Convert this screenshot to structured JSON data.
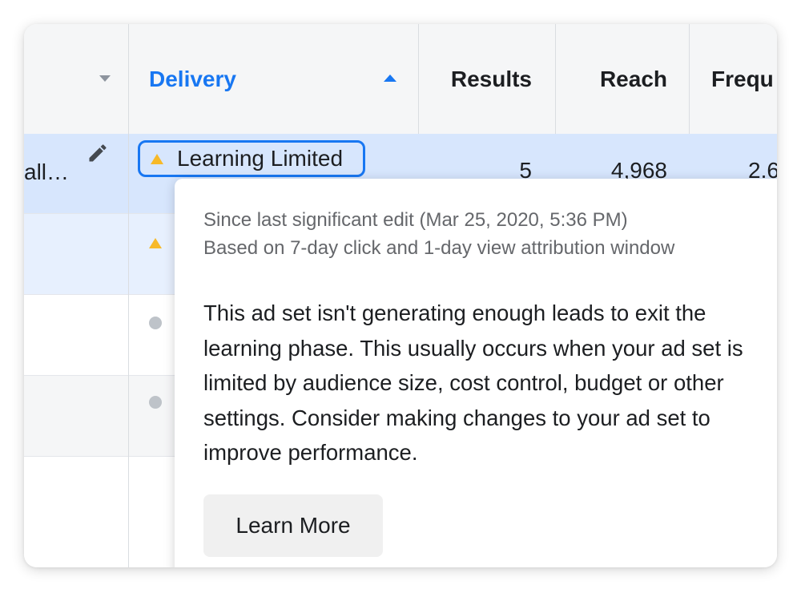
{
  "header": {
    "columns": [
      {
        "label": ""
      },
      {
        "label": "Delivery",
        "sort": "ascending"
      },
      {
        "label": "Results"
      },
      {
        "label": "Reach"
      },
      {
        "label": "Frequ"
      }
    ]
  },
  "rows": [
    {
      "name": "all…",
      "delivery_status": "Learning Limited",
      "status_icon": "warning-triangle-icon",
      "results": "5",
      "reach": "4,968",
      "frequency": "2.6",
      "selected": true
    },
    {
      "status_icon": "warning-triangle-icon",
      "selected": true
    },
    {
      "status_icon": "inactive-dot-icon"
    },
    {
      "status_icon": "inactive-dot-icon"
    },
    {}
  ],
  "tooltip": {
    "meta_line_1": "Since last significant edit (Mar 25, 2020, 5:36 PM)",
    "meta_line_2": "Based on 7-day click and 1-day view attribution window",
    "description": "This ad set isn't generating enough leads to exit the learning phase. This usually occurs when your ad set is limited by audience size, cost control, budget or other settings. Consider making changes to your ad set to improve performance.",
    "button_label": "Learn More"
  },
  "colors": {
    "accent_blue": "#1877f2",
    "warning_yellow": "#f7b928",
    "selected_row": "#d7e6fd",
    "inactive_gray": "#bec3c9"
  }
}
